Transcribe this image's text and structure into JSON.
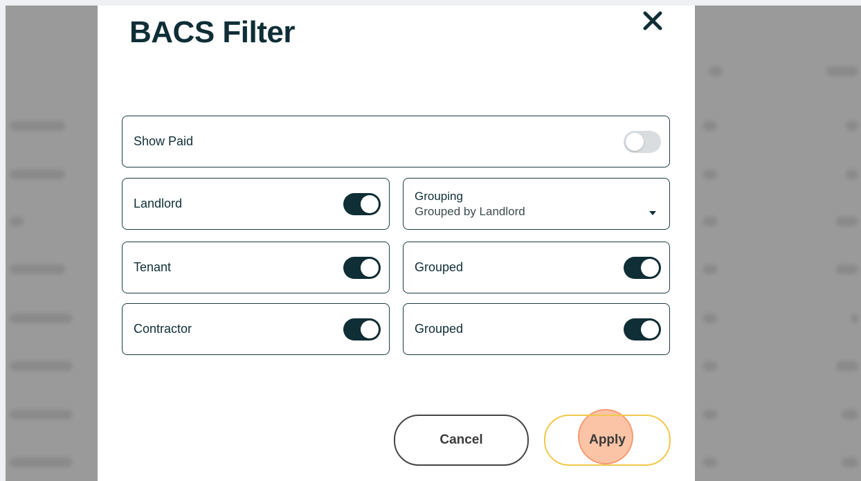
{
  "modal": {
    "title": "BACS Filter",
    "close_icon": "close-icon"
  },
  "filters": {
    "show_paid": {
      "label": "Show Paid",
      "enabled": false
    },
    "landlord": {
      "label": "Landlord",
      "enabled": true
    },
    "grouping": {
      "label": "Grouping",
      "value": "Grouped by Landlord"
    },
    "tenant": {
      "label": "Tenant",
      "enabled": true
    },
    "tenant_grouped": {
      "label": "Grouped",
      "enabled": true
    },
    "contractor": {
      "label": "Contractor",
      "enabled": true
    },
    "contractor_grouped": {
      "label": "Grouped",
      "enabled": true
    }
  },
  "actions": {
    "cancel_label": "Cancel",
    "apply_label": "Apply"
  },
  "colors": {
    "toggle_on": "#0f2e36",
    "toggle_off": "#d9dde0",
    "apply_border": "#f2c84b",
    "click_indicator": "#f7935c"
  }
}
